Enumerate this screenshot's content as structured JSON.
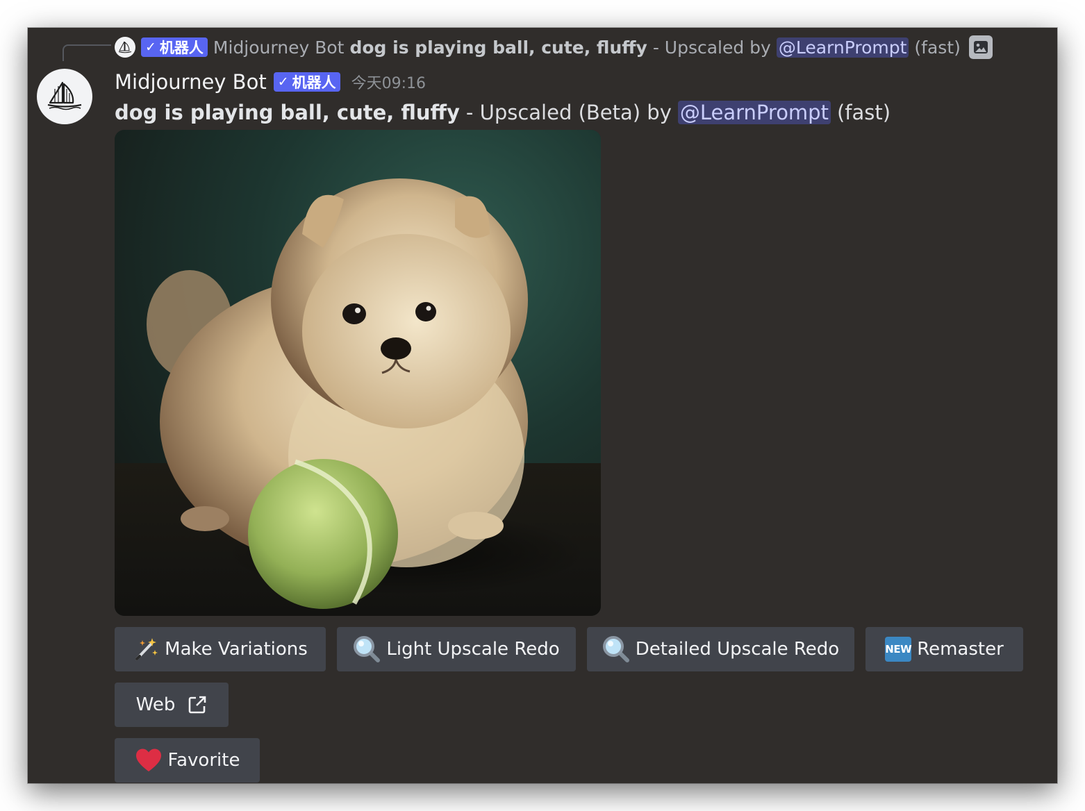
{
  "reply": {
    "badge_check": "✓",
    "badge_text": "机器人",
    "author": "Midjourney Bot",
    "prompt": "dog is playing ball, cute, fluffy",
    "text": "- Upscaled by",
    "mention": "@LearnPrompt",
    "suffix": "(fast)"
  },
  "message": {
    "username": "Midjourney Bot",
    "badge_check": "✓",
    "badge_text": "机器人",
    "timestamp": "今天09:16",
    "prompt": "dog is playing ball, cute, fluffy",
    "text": "- Upscaled (Beta) by",
    "mention": "@LearnPrompt",
    "suffix": "(fast)"
  },
  "buttons": {
    "make_variations": "Make Variations",
    "light_upscale_redo": "Light Upscale Redo",
    "detailed_upscale_redo": "Detailed Upscale Redo",
    "remaster": "Remaster",
    "remaster_new_badge": "NEW",
    "web": "Web",
    "favorite": "Favorite"
  },
  "icons": {
    "make_variations": "magic-wand-icon",
    "light_upscale_redo": "magnifier-icon",
    "detailed_upscale_redo": "magnifier-icon",
    "remaster": "new-badge-icon",
    "web": "external-link-icon",
    "favorite": "heart-icon",
    "attachment": "image-icon"
  },
  "colors": {
    "background": "#302d2b",
    "badge": "#5865f2",
    "button": "#41444b",
    "mention_bg": "#5865f2"
  }
}
